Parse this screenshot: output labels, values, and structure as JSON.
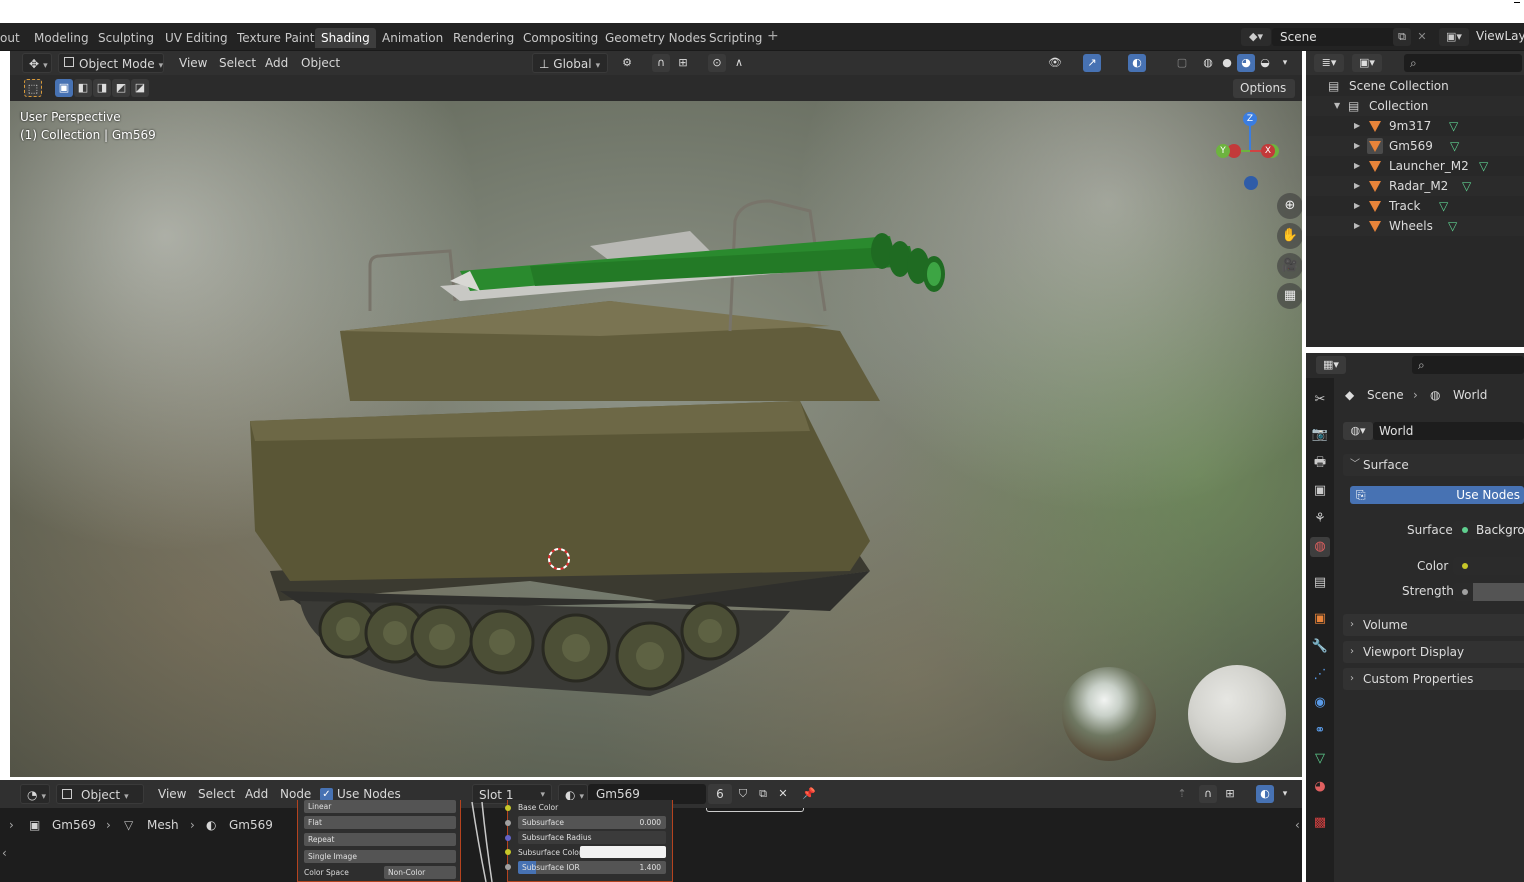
{
  "topbar": {
    "tabs": [
      "out",
      "Modeling",
      "Sculpting",
      "UV Editing",
      "Texture Paint",
      "Shading",
      "Animation",
      "Rendering",
      "Compositing",
      "Geometry Nodes",
      "Scripting"
    ],
    "active_tab": "Shading",
    "add_tab": "+",
    "scene": "Scene",
    "view_layer": "ViewLaye"
  },
  "viewport_header": {
    "mode": "Object Mode",
    "menus": [
      "View",
      "Select",
      "Add",
      "Object"
    ],
    "transform_orientation": "Global",
    "options": "Options"
  },
  "viewport": {
    "perspective": "User Perspective",
    "collection_info": "(1) Collection | Gm569",
    "gizmo": {
      "z": "Z",
      "y": "Y",
      "x": "X"
    }
  },
  "node_header": {
    "editor_type": "Object",
    "menus": [
      "View",
      "Select",
      "Add",
      "Node"
    ],
    "use_nodes_label": "Use Nodes",
    "use_nodes_checked": true,
    "slot": "Slot 1",
    "material": "Gm569",
    "users": "6"
  },
  "breadcrumb": {
    "object": "Gm569",
    "mesh": "Mesh",
    "material": "Gm569"
  },
  "image_node": {
    "interpolation_hidden": "Linear",
    "projection": "Flat",
    "extension": "Repeat",
    "source": "Single Image",
    "color_space_label": "Color Space",
    "color_space": "Non-Color"
  },
  "bsdf_node": {
    "base_color": "Base Color",
    "subsurface_label": "Subsurface",
    "subsurface_value": "0.000",
    "subsurface_radius": "Subsurface Radius",
    "subsurface_color": "Subsurface Color",
    "subsurface_ior_label": "Subsurface IOR",
    "subsurface_ior_value": "1.400"
  },
  "outliner": {
    "root": "Scene Collection",
    "collection": "Collection",
    "objects": [
      "9m317",
      "Gm569",
      "Launcher_M2",
      "Radar_M2",
      "Track",
      "Wheels"
    ]
  },
  "properties": {
    "breadcrumb_scene": "Scene",
    "breadcrumb_world": "World",
    "world_name": "World",
    "surface_panel": "Surface",
    "use_nodes_button": "Use Nodes",
    "surface_label": "Surface",
    "surface_value": "Backgrou",
    "color_label": "Color",
    "strength_label": "Strength",
    "panels": [
      "Volume",
      "Viewport Display",
      "Custom Properties"
    ]
  },
  "colors": {
    "accent": "#4772b3",
    "object_orange": "#e8843a",
    "mesh_green": "#5fcf8f"
  }
}
